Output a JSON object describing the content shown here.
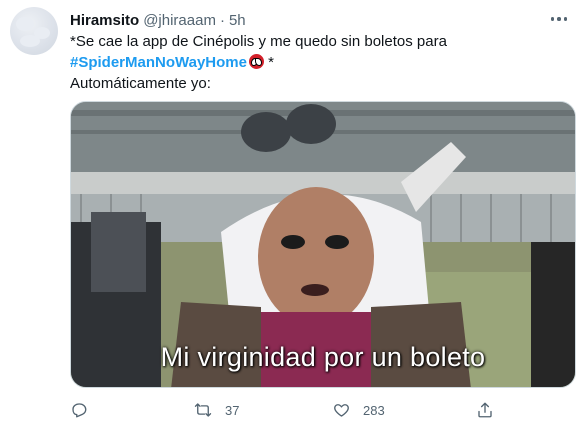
{
  "tweet": {
    "author_name": "Hiramsito",
    "handle": "@jhiraaam",
    "separator": "·",
    "time": "5h",
    "text_line1": "*Se cae la app de Cinépolis y me quedo sin boletos para",
    "hashtag": "#SpiderManNoWayHome",
    "text_after_hashtag": " *",
    "text_line3": "Automáticamente yo:",
    "media_caption": "Mi virginidad por un boleto"
  },
  "actions": {
    "reply_count": "",
    "retweet_count": "37",
    "like_count": "283",
    "share_count": ""
  },
  "icons": {
    "hashtag_emoji": "spider-man-mask-icon",
    "reply": "reply-icon",
    "retweet": "retweet-icon",
    "like": "heart-icon",
    "share": "share-icon",
    "more": "more-icon"
  },
  "colors": {
    "hashtag": "#1d9bf0",
    "secondary_text": "#536471",
    "primary_text": "#0f1419"
  }
}
